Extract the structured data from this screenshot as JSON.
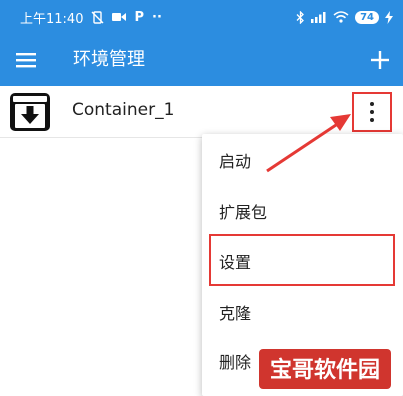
{
  "status_bar": {
    "time": "上午11:40",
    "battery": "74",
    "left_icons": [
      "vibrate-off-icon",
      "video-icon",
      "p-icon",
      "more-dots-icon"
    ],
    "right_icons": [
      "bluetooth-icon",
      "signal-icon",
      "wifi-icon",
      "battery-icon",
      "charging-icon"
    ],
    "p_glyph": "P",
    "dots_glyph": "··"
  },
  "app_bar": {
    "title": "环境管理",
    "background": "#2c8de0"
  },
  "list": {
    "items": [
      {
        "name": "Container_1",
        "icon": "container-download-icon"
      }
    ]
  },
  "context_menu": {
    "items": [
      {
        "label": "启动"
      },
      {
        "label": "扩展包"
      },
      {
        "label": "设置"
      },
      {
        "label": "克隆"
      },
      {
        "label": "删除"
      }
    ]
  },
  "annotations": {
    "highlight_color": "#e53935"
  },
  "watermark": {
    "text": "宝哥软件园",
    "background": "#d0352e"
  }
}
